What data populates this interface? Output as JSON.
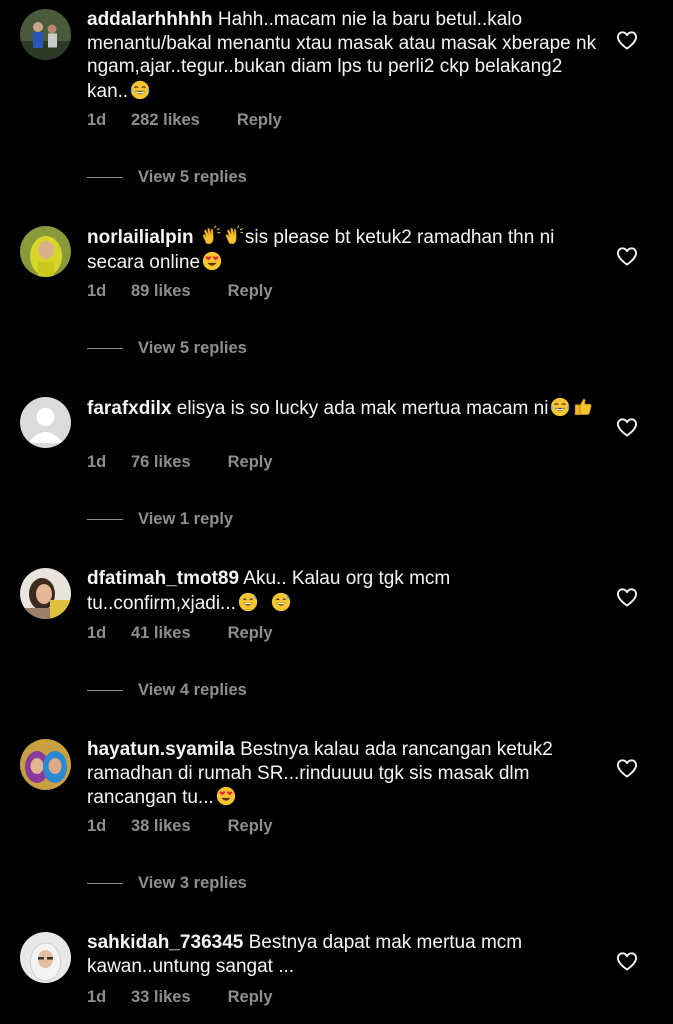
{
  "colors": {
    "background": "#000000",
    "primary_text": "#f5f5f5",
    "secondary_text": "#8e8e8e"
  },
  "comments": [
    {
      "username": "addalarhhhhh",
      "text": "Hahh..macam nie la baru betul..kalo menantu/bakal menantu xtau masak atau masak xberape nk ngam,ajar..tegur..bukan diam lps tu perli2 ckp belakang2 kan..",
      "emoji": [
        "face-with-tears-of-joy"
      ],
      "age": "1d",
      "likes": "282 likes",
      "reply": "Reply",
      "view_replies": "View 5 replies",
      "like_icon": "heart-outline"
    },
    {
      "username": "norlailialpin",
      "text_prefix_emoji": [
        "clapping-hands",
        "clapping-hands"
      ],
      "text": "sis please bt ketuk2 ramadhan thn ni secara online",
      "emoji": [
        "heart-eyes"
      ],
      "age": "1d",
      "likes": "89 likes",
      "reply": "Reply",
      "view_replies": "View 5 replies",
      "like_icon": "heart-outline"
    },
    {
      "username": "farafxdilx",
      "text": "elisya is so lucky ada mak mertua macam ni",
      "emoji": [
        "face-with-tears-of-joy",
        "thumbs-up"
      ],
      "age": "1d",
      "likes": "76 likes",
      "reply": "Reply",
      "view_replies": "View 1 reply",
      "like_icon": "heart-outline"
    },
    {
      "username": "dfatimah_tmot89",
      "text": "Aku.. Kalau org tgk mcm tu..confirm,xjadi...",
      "emoji": [
        "grinning-sweat",
        "grinning-sweat"
      ],
      "age": "1d",
      "likes": "41 likes",
      "reply": "Reply",
      "view_replies": "View 4 replies",
      "like_icon": "heart-outline"
    },
    {
      "username": "hayatun.syamila",
      "text": "Bestnya kalau ada rancangan ketuk2 ramadhan di rumah SR...rinduuuu tgk sis masak dlm rancangan tu...",
      "emoji": [
        "heart-eyes"
      ],
      "age": "1d",
      "likes": "38 likes",
      "reply": "Reply",
      "view_replies": "View 3 replies",
      "like_icon": "heart-outline"
    },
    {
      "username": "sahkidah_736345",
      "text": "Bestnya dapat mak mertua mcm kawan..untung sangat ...",
      "emoji": [],
      "age": "1d",
      "likes": "33 likes",
      "reply": "Reply",
      "like_icon": "heart-outline"
    }
  ]
}
